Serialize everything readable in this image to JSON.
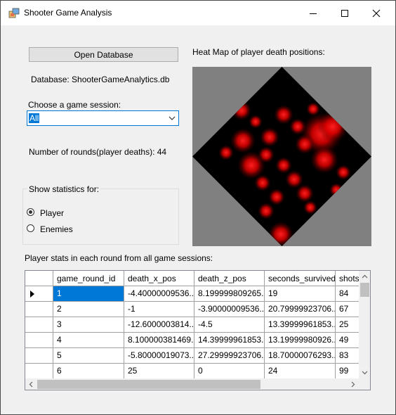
{
  "window": {
    "title": "Shooter Game Analysis"
  },
  "controls": {
    "open_db_label": "Open Database",
    "database_label": "Database: ShooterGameAnalytics.db",
    "session_prompt": "Choose a game session:",
    "session_selected": "All",
    "rounds_label": "Number of rounds(player deaths): 44",
    "stats_group_label": "Show statistics for:",
    "radio_player": "Player",
    "radio_enemies": "Enemies",
    "heatmap_label": "Heat Map of player death positions:",
    "grid_caption": "Player stats in each round from all game sessions:"
  },
  "grid": {
    "columns": [
      "game_round_id",
      "death_x_pos",
      "death_z_pos",
      "seconds_survived",
      "shots_"
    ],
    "rows": [
      [
        "1",
        "-4.40000009536...",
        "8.199999809265...",
        "19",
        "84"
      ],
      [
        "2",
        "-1",
        "-3.90000009536...",
        "20.79999923706...",
        "67"
      ],
      [
        "3",
        "-12.6000003814...",
        "-4.5",
        "13.39999961853...",
        "25"
      ],
      [
        "4",
        "8.100000381469...",
        "14.39999961853...",
        "13.19999980926...",
        "49"
      ],
      [
        "5",
        "-5.80000019073...",
        "27.29999923706...",
        "18.70000076293...",
        "83"
      ],
      [
        "6",
        "25",
        "0",
        "24",
        "99"
      ]
    ]
  },
  "colors": {
    "accent": "#0078d7",
    "heat": "#ff0000",
    "heat_bg": "#808080"
  },
  "icons": [
    "app-icon",
    "minimize-icon",
    "maximize-icon",
    "close-icon",
    "chevron-down-icon",
    "row-pointer-icon",
    "scroll-up-icon",
    "scroll-down-icon",
    "scroll-left-icon",
    "scroll-right-icon"
  ]
}
